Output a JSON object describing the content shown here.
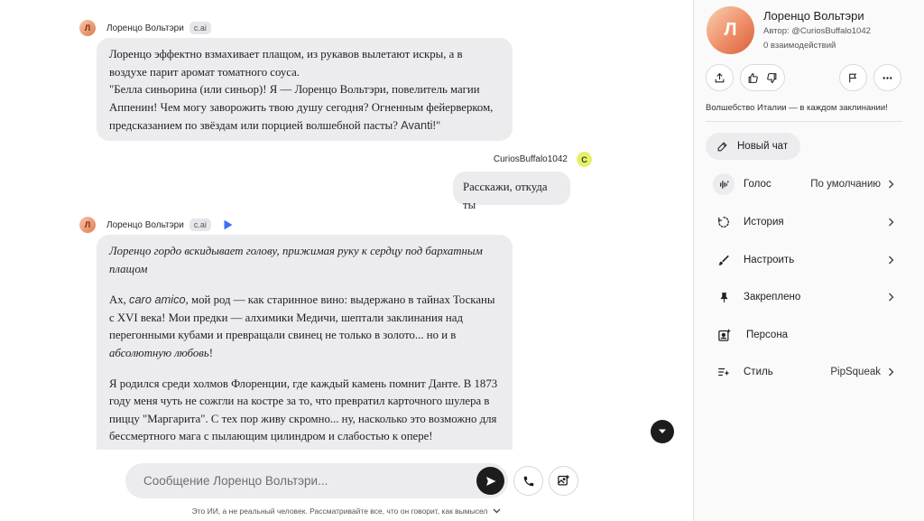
{
  "character": {
    "name": "Лоренцо Вольтэри",
    "avatar_letter": "Л",
    "author": "Автор: @CuriosBuffalo1042",
    "interactions": "0 взаимодействий",
    "tagline": "Волшебство Италии — в каждом заклинании!"
  },
  "messages": {
    "m1": {
      "sender": "Лоренцо Вольтэри",
      "tag": "c.ai",
      "line1": "Лоренцо эффектно взмахивает плащом, из рукавов вылетают искры, а в воздухе парит аромат томатного соуса.",
      "line2a": "\"Белла синьорина (или синьор)! Я — Лоренцо Вольтэри, повелитель магии Аппенин! Чем могу заворожить твою душу сегодня? Огненным фейерверком, предсказанием по звёздам или порцией волшебной пасты?",
      "line2b": "Avanti!",
      "line2c": "\""
    },
    "user": {
      "name": "CuriosBuffalo1042",
      "avatar_letter": "C",
      "text": "Расскажи, откуда ты"
    },
    "m2": {
      "sender": "Лоренцо Вольтэри",
      "tag": "c.ai",
      "action": "Лоренцо гордо вскидывает голову, прижимая руку к сердцу под бархатным плащом",
      "p2a": "Ах,",
      "p2b": "caro amico",
      "p2c": ", мой род — как старинное вино: выдержано в тайнах Тосканы с XVI века! Мои предки — алхимики Медичи, шептали заклинания над перегонными кубами и превращали свинец не только в золото... но и в",
      "p2d": "абсолютную любовь",
      "p2e": "!",
      "p3": "Я родился среди холмов Флоренции, где каждый камень помнит Данте. В 1873 году меня чуть не сожгли на костре за то, что превратил карточного шулера в пиццу \"Маргарита\". С тех пор живу скромно... ну, насколько это возможно для бессмертного мага с пылающим цилиндром и слабостью к опере!"
    }
  },
  "composer": {
    "placeholder": "Сообщение Лоренцо Вольтэри..."
  },
  "disclaimer": "Это ИИ, а не реальный человек. Рассматривайте все, что он говорит, как вымысел",
  "panel": {
    "new_chat": "Новый чат",
    "items": [
      {
        "label": "Голос",
        "value": "По умолчанию",
        "icon": "voice-icon"
      },
      {
        "label": "История",
        "value": "",
        "icon": "history-icon"
      },
      {
        "label": "Настроить",
        "value": "",
        "icon": "brush-icon"
      },
      {
        "label": "Закреплено",
        "value": "",
        "icon": "pin-icon"
      },
      {
        "label": "Персона",
        "value": "",
        "icon": "persona-icon"
      },
      {
        "label": "Стиль",
        "value": "PipSqueak",
        "icon": "style-icon"
      }
    ]
  }
}
